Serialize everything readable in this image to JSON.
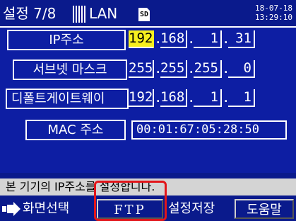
{
  "header": {
    "title": "설정 7/8",
    "page": "LAN",
    "sd_label": "SD",
    "date": "18-07-18",
    "time": "13:29:10"
  },
  "rows": [
    {
      "label": "IP주소",
      "octets": [
        "192",
        "168",
        "1",
        "31"
      ],
      "selected_index": 0
    },
    {
      "label": "서브넷 마스크",
      "octets": [
        "255",
        "255",
        "255",
        "0"
      ]
    },
    {
      "label": "디폴트게이트웨이",
      "octets": [
        "192",
        "168",
        "1",
        "1"
      ]
    }
  ],
  "mac": {
    "label": "MAC 주소",
    "value": "00:01:67:05:28:50"
  },
  "status_message": "본 기기의 IP주소를 설정합니다.",
  "function_keys": [
    "화면선택",
    "FTP",
    "설정저장",
    "도움말"
  ],
  "colors": {
    "background": "#0a1a8c",
    "selection": "#f6ef1f",
    "highlight": "#e2151a",
    "status_bar": "#d4d4d4"
  },
  "icons": {
    "sd": "sd-card-icon",
    "arrow": "screen-select-arrow-icon",
    "signal": "signal-bars-icon"
  }
}
